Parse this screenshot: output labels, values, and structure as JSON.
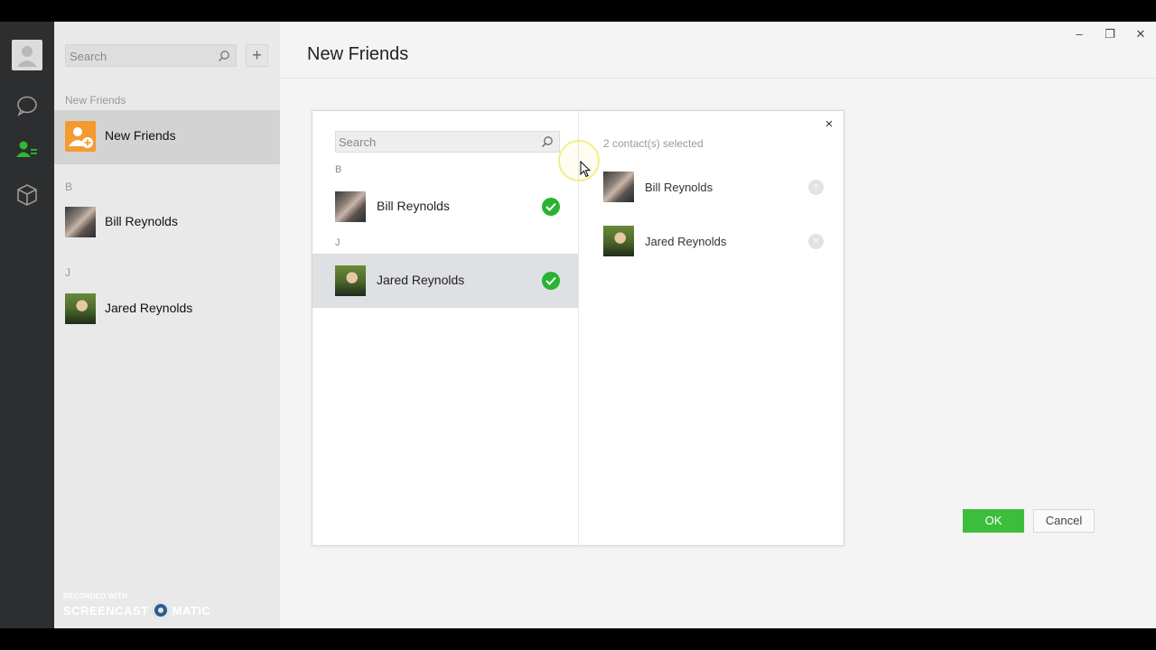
{
  "app": {
    "search_placeholder": "Search",
    "add_button": "+",
    "page_title": "New Friends",
    "window_controls": {
      "minimize": "–",
      "restore": "❐",
      "close": "✕"
    }
  },
  "list": {
    "sections": [
      {
        "label": "New Friends"
      },
      {
        "label": "B"
      },
      {
        "label": "J"
      }
    ],
    "items": [
      {
        "name": "New Friends"
      },
      {
        "name": "Bill Reynolds"
      },
      {
        "name": "Jared Reynolds"
      }
    ]
  },
  "dialog": {
    "search_placeholder": "Search",
    "letters": [
      "B",
      "J"
    ],
    "contacts": [
      {
        "name": "Bill Reynolds",
        "checked": true
      },
      {
        "name": "Jared Reynolds",
        "checked": true
      }
    ],
    "selected_label": "2 contact(s) selected",
    "selected": [
      {
        "name": "Bill Reynolds"
      },
      {
        "name": "Jared Reynolds"
      }
    ],
    "close": "×",
    "remove_glyph": "×",
    "ok_label": "OK",
    "cancel_label": "Cancel"
  },
  "watermark": {
    "line1": "RECORDED WITH",
    "line2a": "SCREENCAST",
    "line2b": "MATIC"
  },
  "colors": {
    "accent_green": "#3cbe3c",
    "rail": "#2d2e30",
    "new_friends_icon": "#f49a31"
  }
}
